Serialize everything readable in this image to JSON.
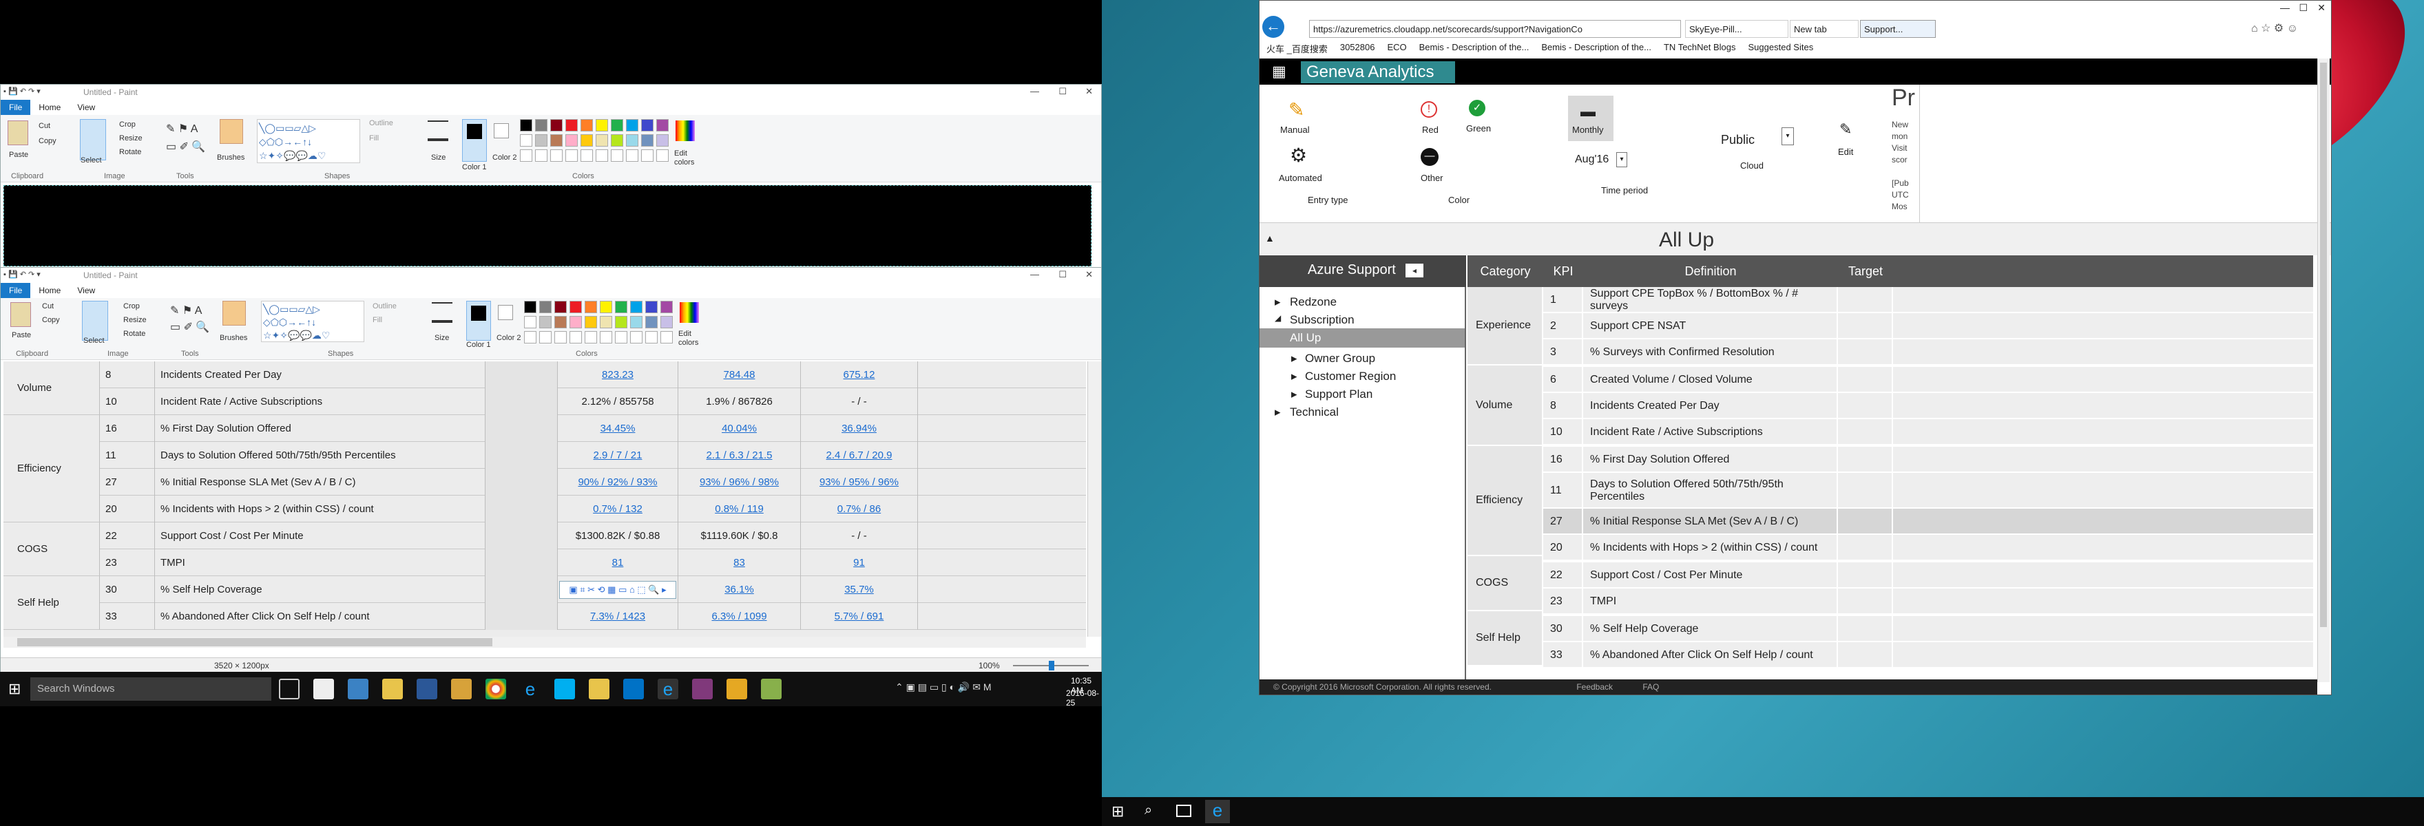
{
  "paint_back": {
    "title": "Untitled - Paint",
    "tabs": [
      "File",
      "Home",
      "View"
    ],
    "groups": [
      "Clipboard",
      "Image",
      "Tools",
      "Shapes",
      "Colors"
    ],
    "tools": {
      "paste": "Paste",
      "cut": "Cut",
      "copy": "Copy",
      "select": "Select",
      "crop": "Crop",
      "resize": "Resize",
      "rotate": "Rotate",
      "brushes": "Brushes",
      "outline": "Outline",
      "fill": "Fill",
      "size": "Size",
      "color1": "Color 1",
      "color2": "Color 2",
      "edit_colors": "Edit colors"
    }
  },
  "paint_front": {
    "title": "Untitled - Paint",
    "tabs": [
      "File",
      "Home",
      "View"
    ],
    "groups": [
      "Clipboard",
      "Image",
      "Tools",
      "Shapes",
      "Colors"
    ],
    "tools": {
      "paste": "Paste",
      "cut": "Cut",
      "copy": "Copy",
      "select": "Select",
      "crop": "Crop",
      "resize": "Resize",
      "rotate": "Rotate",
      "brushes": "Brushes",
      "outline": "Outline",
      "fill": "Fill",
      "size": "Size",
      "color1": "Color 1",
      "color2": "Color 2",
      "edit_colors": "Edit colors"
    },
    "groups_rows": [
      {
        "label": "Volume"
      },
      {
        "label": "Efficiency"
      },
      {
        "label": "COGS"
      },
      {
        "label": "Self Help"
      }
    ],
    "rows": [
      {
        "id": "8",
        "def": "Incidents Created Per Day",
        "v1": "823.23",
        "v2": "784.48",
        "v3": "675.12"
      },
      {
        "id": "10",
        "def": "Incident Rate / Active Subscriptions",
        "v1": "2.12% / 855758",
        "v2": "1.9% / 867826",
        "v3": "- / -"
      },
      {
        "id": "16",
        "def": "% First Day Solution Offered",
        "v1": "34.45%",
        "v2": "40.04%",
        "v3": "36.94%"
      },
      {
        "id": "11",
        "def": "Days to Solution Offered 50th/75th/95th Percentiles",
        "v1": "2.9 / 7 / 21",
        "v2": "2.1 / 6.3 / 21.5",
        "v3": "2.4 / 6.7 / 20.9"
      },
      {
        "id": "27",
        "def": "% Initial Response SLA Met (Sev A / B / C)",
        "v1": "90% / 92% / 93%",
        "v2": "93% / 96% / 98%",
        "v3": "93% / 95% / 96%"
      },
      {
        "id": "20",
        "def": "% Incidents with Hops > 2 (within CSS) / count",
        "v1": "0.7% / 132",
        "v2": "0.8% / 119",
        "v3": "0.7% / 86"
      },
      {
        "id": "22",
        "def": "Support Cost / Cost Per Minute",
        "v1": "$1300.82K / $0.88",
        "v2": "$1119.60K / $0.8",
        "v3": "- / -"
      },
      {
        "id": "23",
        "def": "TMPI",
        "v1": "81",
        "v2": "83",
        "v3": "91"
      },
      {
        "id": "30",
        "def": "% Self Help Coverage",
        "v1": "",
        "v2": "36.1%",
        "v3": "35.7%"
      },
      {
        "id": "33",
        "def": "% Abandoned After Click On Self Help / count",
        "v1": "7.3% / 1423",
        "v2": "6.3% / 1099",
        "v3": "5.7% / 691"
      }
    ],
    "status": {
      "size": "3520 × 1200px",
      "zoom": "100%"
    }
  },
  "taskbar_left": {
    "search_placeholder": "Search Windows",
    "time": "10:35 AM",
    "date": "2016-08-25"
  },
  "ie": {
    "url": "https://azuremetrics.cloudapp.net/scorecards/support?NavigationCo",
    "tabs": [
      "SkyEye-Pill...",
      "New tab",
      "Support..."
    ],
    "favorites": [
      "火车 _百度搜索",
      "3052806",
      "ECO",
      "Bemis - Description of the...",
      "Bemis - Description of the...",
      "TN TechNet Blogs",
      "Suggested Sites"
    ],
    "app_name": "Geneva Analytics",
    "toolbar": {
      "manual": "Manual",
      "automated": "Automated",
      "entry_type": "Entry type",
      "red": "Red",
      "green": "Green",
      "other": "Other",
      "color": "Color",
      "monthly": "Monthly",
      "period": "Aug'16",
      "time_period": "Time period",
      "cloud_value": "Public",
      "cloud": "Cloud",
      "edit": "Edit",
      "notes": "New\nmon\nVisit\nscor\n\n[Pub\nUTC\nMos",
      "pr": "Pr"
    },
    "page_title": "All Up",
    "sidebar_title": "Azure Support",
    "tree": [
      {
        "label": "Redzone"
      },
      {
        "label": "Subscription"
      },
      {
        "label": "All Up"
      },
      {
        "label": "Owner Group"
      },
      {
        "label": "Customer Region"
      },
      {
        "label": "Support Plan"
      },
      {
        "label": "Technical"
      }
    ],
    "columns": [
      "Category",
      "KPI",
      "Definition",
      "Target"
    ],
    "categories": [
      "Experience",
      "Volume",
      "Efficiency",
      "COGS",
      "Self Help"
    ],
    "kpis": [
      {
        "id": "1",
        "def": "Support CPE TopBox % / BottomBox % / # surveys"
      },
      {
        "id": "2",
        "def": "Support CPE NSAT"
      },
      {
        "id": "3",
        "def": "% Surveys with Confirmed Resolution"
      },
      {
        "id": "6",
        "def": "Created Volume / Closed Volume"
      },
      {
        "id": "8",
        "def": "Incidents Created Per Day"
      },
      {
        "id": "10",
        "def": "Incident Rate / Active Subscriptions"
      },
      {
        "id": "16",
        "def": "% First Day Solution Offered"
      },
      {
        "id": "11",
        "def": "Days to Solution Offered 50th/75th/95th Percentiles"
      },
      {
        "id": "27",
        "def": "% Initial Response SLA Met (Sev A / B / C)"
      },
      {
        "id": "20",
        "def": "% Incidents with Hops > 2 (within CSS) / count"
      },
      {
        "id": "22",
        "def": "Support Cost / Cost Per Minute"
      },
      {
        "id": "23",
        "def": "TMPI"
      },
      {
        "id": "30",
        "def": "% Self Help Coverage"
      },
      {
        "id": "33",
        "def": "% Abandoned After Click On Self Help / count"
      }
    ],
    "footer": "© Copyright 2016 Microsoft Corporation. All rights reserved.",
    "footer_links": [
      "Feedback",
      "FAQ"
    ]
  },
  "colors": {
    "accent": "#1979ca",
    "teal": "#2f8a8f",
    "link": "#1a6bd0"
  }
}
